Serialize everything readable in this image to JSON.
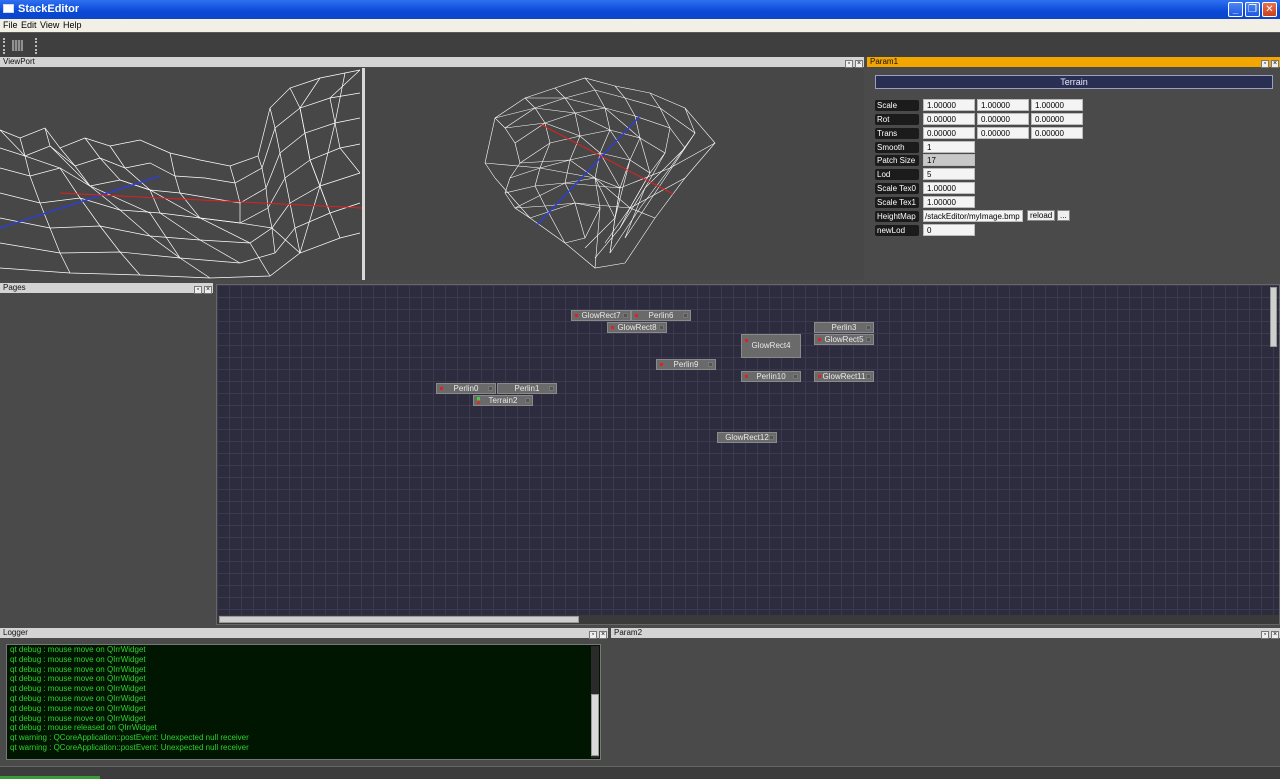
{
  "window": {
    "title": "StackEditor"
  },
  "menu": {
    "items": [
      "File",
      "Edit",
      "View",
      "Help"
    ]
  },
  "docks": {
    "viewport": "ViewPort",
    "param1": "Param1",
    "pages": "Pages",
    "logger": "Logger",
    "param2": "Param2"
  },
  "param1": {
    "header": "Terrain",
    "rows": {
      "scale": {
        "label": "Scale",
        "values": [
          "1.00000",
          "1.00000",
          "1.00000"
        ]
      },
      "rot": {
        "label": "Rot",
        "values": [
          "0.00000",
          "0.00000",
          "0.00000"
        ]
      },
      "trans": {
        "label": "Trans",
        "values": [
          "0.00000",
          "0.00000",
          "0.00000"
        ]
      },
      "smooth": {
        "label": "Smooth",
        "value": "1"
      },
      "patch_size": {
        "label": "Patch Size",
        "value": "17"
      },
      "lod": {
        "label": "Lod",
        "value": "5"
      },
      "scale_tex0": {
        "label": "Scale Tex0",
        "value": "1.00000"
      },
      "scale_tex1": {
        "label": "Scale Tex1",
        "value": "1.00000"
      },
      "heightmap": {
        "label": "HeightMap",
        "value": "/stackEditor/myImage.bmp",
        "reload": "reload",
        "browse": "..."
      },
      "new_lod": {
        "label": "newLod",
        "value": "0"
      }
    }
  },
  "graph": {
    "nodes": [
      {
        "id": "glowrect7",
        "label": "GlowRect7"
      },
      {
        "id": "perlin6",
        "label": "Perlin6"
      },
      {
        "id": "glowrect8",
        "label": "GlowRect8"
      },
      {
        "id": "perlin3",
        "label": "Perlin3"
      },
      {
        "id": "glowrect4",
        "label": "GlowRect4"
      },
      {
        "id": "glowrect5",
        "label": "GlowRect5"
      },
      {
        "id": "perlin9",
        "label": "Perlin9"
      },
      {
        "id": "perlin10",
        "label": "Perlin10"
      },
      {
        "id": "glowrect11",
        "label": "GlowRect11"
      },
      {
        "id": "perlin0",
        "label": "Perlin0"
      },
      {
        "id": "perlin1",
        "label": "Perlin1"
      },
      {
        "id": "terrain2",
        "label": "Terrain2"
      },
      {
        "id": "glowrect12",
        "label": "GlowRect12"
      }
    ]
  },
  "logger": {
    "lines": [
      "qt debug : mouse move on QIrrWidget",
      "qt debug : mouse move on QIrrWidget",
      "qt debug : mouse move on QIrrWidget",
      "qt debug : mouse move on QIrrWidget",
      "qt debug : mouse move on QIrrWidget",
      "qt debug : mouse move on QIrrWidget",
      "qt debug : mouse move on QIrrWidget",
      "qt debug : mouse move on QIrrWidget",
      "qt debug : mouse released on QIrrWidget",
      "qt warning : QCoreApplication::postEvent: Unexpected null receiver",
      "qt warning : QCoreApplication::postEvent: Unexpected null receiver"
    ]
  },
  "colors": {
    "title_bar": "#0a49d6",
    "active_dock": "#f3a600",
    "log_text": "#2fd12f",
    "graph_bg": "#2d2c3e"
  }
}
